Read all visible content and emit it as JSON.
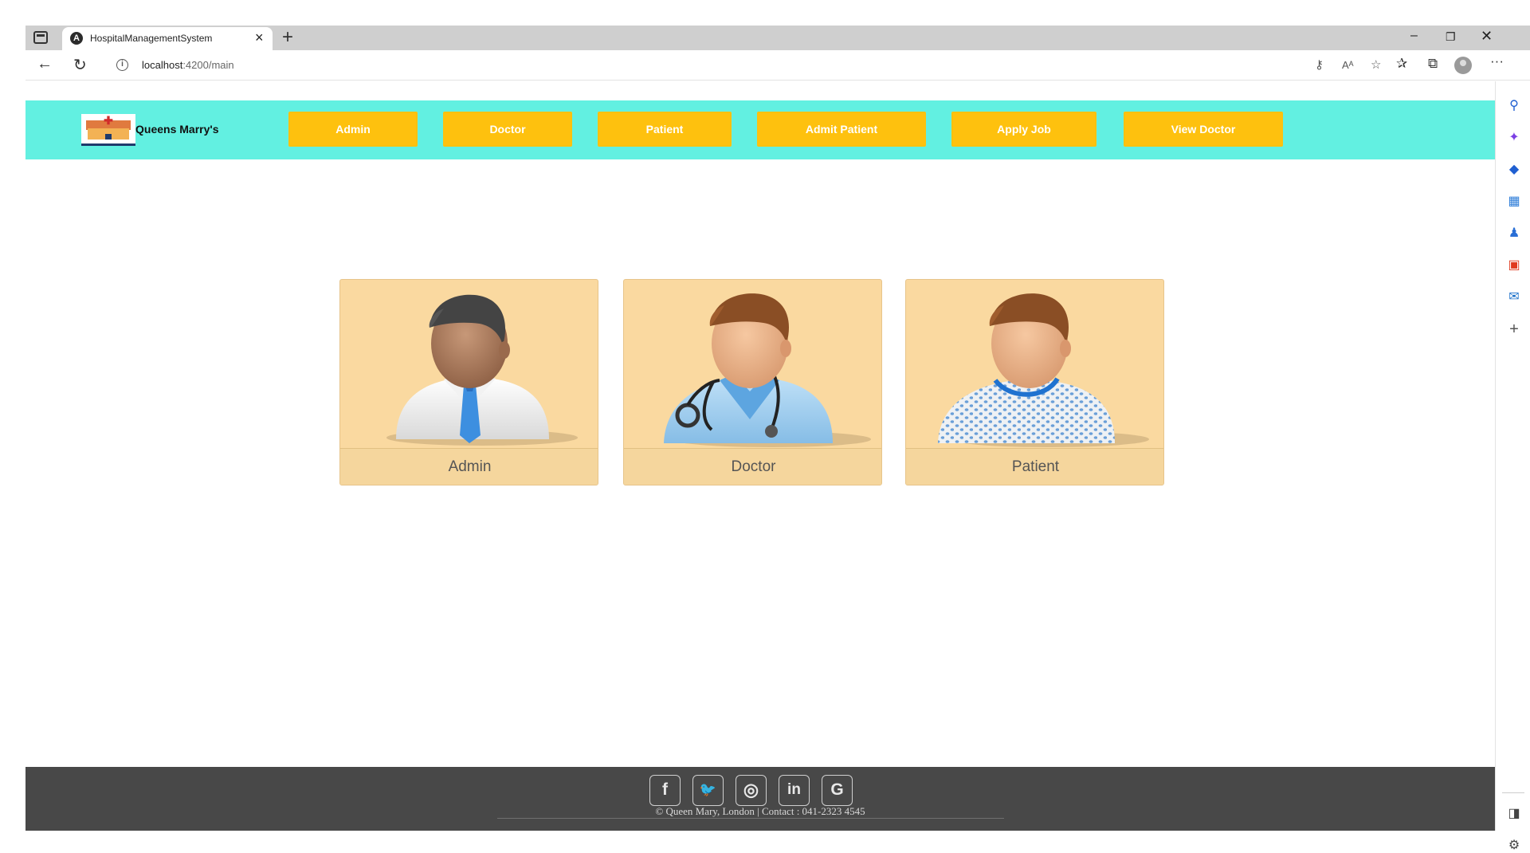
{
  "browser": {
    "tab_title": "HospitalManagementSystem",
    "tab_favicon": "angular-icon",
    "new_tab": "+",
    "url_host": "localhost",
    "url_path": ":4200/main"
  },
  "navbar": {
    "brand": "Queens Marry's",
    "buttons": [
      "Admin",
      "Doctor",
      "Patient",
      "Admit Patient",
      "Apply Job",
      "View Doctor"
    ],
    "background_color": "#62f0e1",
    "button_color": "#fec10e"
  },
  "cards": [
    {
      "label": "Admin",
      "image": "admin-avatar"
    },
    {
      "label": "Doctor",
      "image": "doctor-avatar"
    },
    {
      "label": "Patient",
      "image": "patient-avatar"
    }
  ],
  "footer": {
    "social_icons": [
      "facebook-icon",
      "twitter-icon",
      "instagram-icon",
      "linkedin-icon",
      "google-icon"
    ],
    "social_glyphs": [
      "f",
      "🐦",
      "◎",
      "in",
      "G"
    ],
    "copyright": "© Queen Mary, London | Contact : 041-2323 4545",
    "background_color": "#484848"
  }
}
